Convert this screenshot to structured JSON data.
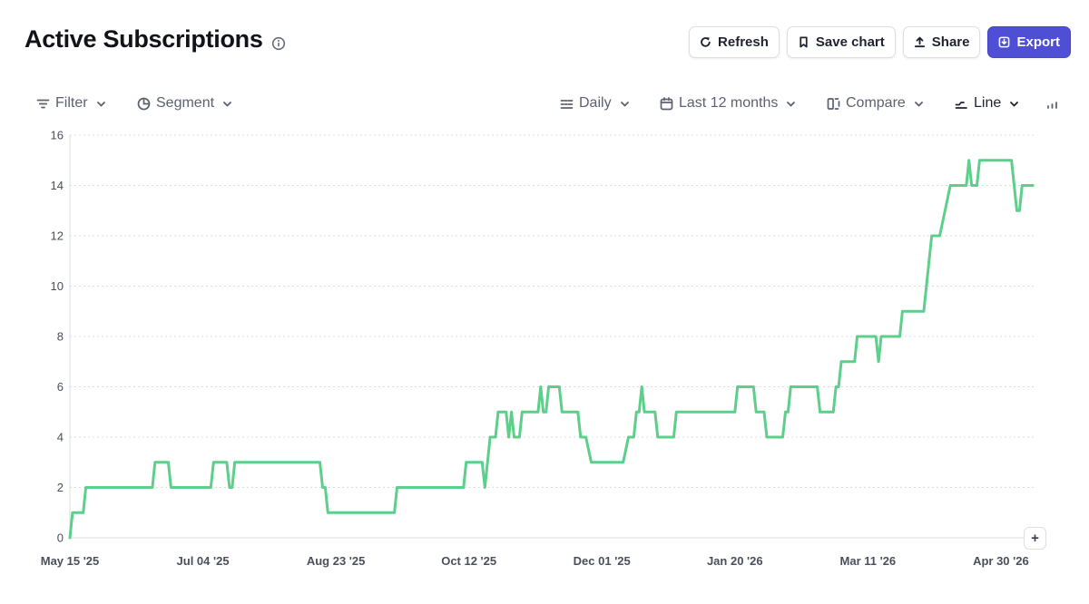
{
  "header": {
    "title": "Active Subscriptions",
    "info_icon": "info-circle-icon",
    "buttons": {
      "refresh": "Refresh",
      "save": "Save chart",
      "share": "Share",
      "export": "Export"
    }
  },
  "toolbar": {
    "filter": "Filter",
    "segment": "Segment",
    "interval": "Daily",
    "range": "Last 12 months",
    "compare": "Compare",
    "chart_type": "Line"
  },
  "colors": {
    "line": "#5ccf8a",
    "primary_button": "#4f4fd6",
    "grid": "#d9dce2"
  },
  "chart_data": {
    "type": "line",
    "title": "Active Subscriptions",
    "xlabel": "",
    "ylabel": "",
    "ylim": [
      0,
      16
    ],
    "y_ticks": [
      "0",
      "2",
      "4",
      "6",
      "8",
      "10",
      "12",
      "14",
      "16"
    ],
    "x_ticks": [
      "May 15 '25",
      "Jul 04 '25",
      "Aug 23 '25",
      "Oct 12 '25",
      "Dec 01 '25",
      "Jan 20 '26",
      "Mar 11 '26",
      "Apr 30 '26"
    ],
    "x_range": [
      "2025-05-15",
      "2026-05-13"
    ],
    "grid": true,
    "series": [
      {
        "color": "#5ccf8a",
        "points": [
          [
            "2025-05-15",
            0
          ],
          [
            "2025-05-16",
            1
          ],
          [
            "2025-05-20",
            1
          ],
          [
            "2025-05-21",
            2
          ],
          [
            "2025-06-15",
            2
          ],
          [
            "2025-06-16",
            3
          ],
          [
            "2025-06-21",
            3
          ],
          [
            "2025-06-22",
            2
          ],
          [
            "2025-07-07",
            2
          ],
          [
            "2025-07-08",
            3
          ],
          [
            "2025-07-13",
            3
          ],
          [
            "2025-07-14",
            2
          ],
          [
            "2025-07-15",
            2
          ],
          [
            "2025-07-16",
            3
          ],
          [
            "2025-08-17",
            3
          ],
          [
            "2025-08-18",
            2
          ],
          [
            "2025-08-19",
            2
          ],
          [
            "2025-08-20",
            1
          ],
          [
            "2025-09-14",
            1
          ],
          [
            "2025-09-15",
            2
          ],
          [
            "2025-10-10",
            2
          ],
          [
            "2025-10-11",
            3
          ],
          [
            "2025-10-17",
            3
          ],
          [
            "2025-10-18",
            2
          ],
          [
            "2025-10-19",
            3
          ],
          [
            "2025-10-20",
            4
          ],
          [
            "2025-10-22",
            4
          ],
          [
            "2025-10-23",
            5
          ],
          [
            "2025-10-26",
            5
          ],
          [
            "2025-10-27",
            4
          ],
          [
            "2025-10-28",
            5
          ],
          [
            "2025-10-29",
            4
          ],
          [
            "2025-10-31",
            4
          ],
          [
            "2025-11-01",
            5
          ],
          [
            "2025-11-07",
            5
          ],
          [
            "2025-11-08",
            6
          ],
          [
            "2025-11-09",
            5
          ],
          [
            "2025-11-10",
            5
          ],
          [
            "2025-11-11",
            6
          ],
          [
            "2025-11-15",
            6
          ],
          [
            "2025-11-16",
            5
          ],
          [
            "2025-11-22",
            5
          ],
          [
            "2025-11-23",
            4
          ],
          [
            "2025-11-25",
            4
          ],
          [
            "2025-11-27",
            3
          ],
          [
            "2025-12-09",
            3
          ],
          [
            "2025-12-11",
            4
          ],
          [
            "2025-12-13",
            4
          ],
          [
            "2025-12-14",
            5
          ],
          [
            "2025-12-15",
            5
          ],
          [
            "2025-12-16",
            6
          ],
          [
            "2025-12-17",
            5
          ],
          [
            "2025-12-21",
            5
          ],
          [
            "2025-12-22",
            4
          ],
          [
            "2025-12-28",
            4
          ],
          [
            "2025-12-29",
            5
          ],
          [
            "2026-01-20",
            5
          ],
          [
            "2026-01-21",
            6
          ],
          [
            "2026-01-27",
            6
          ],
          [
            "2026-01-28",
            5
          ],
          [
            "2026-01-31",
            5
          ],
          [
            "2026-02-01",
            4
          ],
          [
            "2026-02-07",
            4
          ],
          [
            "2026-02-08",
            5
          ],
          [
            "2026-02-09",
            5
          ],
          [
            "2026-02-10",
            6
          ],
          [
            "2026-02-20",
            6
          ],
          [
            "2026-02-21",
            5
          ],
          [
            "2026-02-26",
            5
          ],
          [
            "2026-02-27",
            6
          ],
          [
            "2026-02-28",
            6
          ],
          [
            "2026-03-01",
            7
          ],
          [
            "2026-03-06",
            7
          ],
          [
            "2026-03-07",
            8
          ],
          [
            "2026-03-14",
            8
          ],
          [
            "2026-03-15",
            7
          ],
          [
            "2026-03-16",
            8
          ],
          [
            "2026-03-23",
            8
          ],
          [
            "2026-03-24",
            9
          ],
          [
            "2026-04-01",
            9
          ],
          [
            "2026-04-04",
            12
          ],
          [
            "2026-04-07",
            12
          ],
          [
            "2026-04-11",
            14
          ],
          [
            "2026-04-17",
            14
          ],
          [
            "2026-04-18",
            15
          ],
          [
            "2026-04-19",
            14
          ],
          [
            "2026-04-21",
            14
          ],
          [
            "2026-04-22",
            15
          ],
          [
            "2026-05-04",
            15
          ],
          [
            "2026-05-06",
            13
          ],
          [
            "2026-05-07",
            13
          ],
          [
            "2026-05-08",
            14
          ],
          [
            "2026-05-12",
            14
          ]
        ]
      }
    ]
  }
}
